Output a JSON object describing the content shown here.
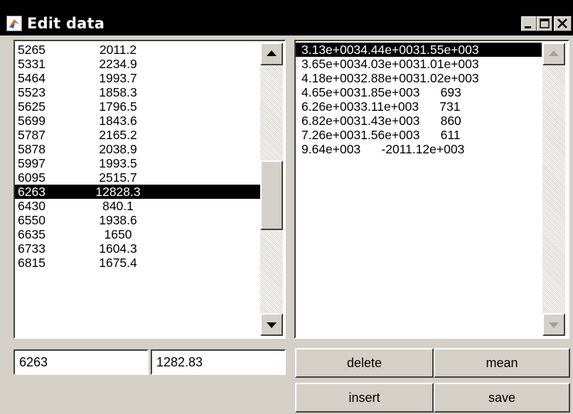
{
  "window": {
    "title": "Edit data"
  },
  "title_buttons": {
    "minimize": "minimize-icon",
    "maximize": "maximize-icon",
    "close": "close-icon"
  },
  "left_list": {
    "rows": [
      {
        "a": "5265",
        "b": "2011.2"
      },
      {
        "a": "5331",
        "b": "2234.9"
      },
      {
        "a": "5464",
        "b": "1993.7"
      },
      {
        "a": "5523",
        "b": "1858.3"
      },
      {
        "a": "5625",
        "b": "1796.5"
      },
      {
        "a": "5699",
        "b": "1843.6"
      },
      {
        "a": "5787",
        "b": "2165.2"
      },
      {
        "a": "5878",
        "b": "2038.9"
      },
      {
        "a": "5997",
        "b": "1993.5"
      },
      {
        "a": "6095",
        "b": "2515.7"
      },
      {
        "a": "6263",
        "b": "12828.3"
      },
      {
        "a": "6430",
        "b": "840.1"
      },
      {
        "a": "6550",
        "b": "1938.6"
      },
      {
        "a": "6635",
        "b": "1650"
      },
      {
        "a": "6733",
        "b": "1604.3"
      },
      {
        "a": "6815",
        "b": "1675.4"
      }
    ],
    "selected_index": 10
  },
  "right_list": {
    "rows": [
      "3.13e+0034.44e+0031.55e+003",
      "3.65e+0034.03e+0031.01e+003",
      "4.18e+0032.88e+0031.02e+003",
      "4.65e+0031.85e+003      693",
      "6.26e+0033.11e+003      731",
      "6.82e+0031.43e+003      860",
      "7.26e+0031.56e+003      611",
      "9.64e+003      -2011.12e+003"
    ],
    "selected_index": 0
  },
  "inputs": {
    "x_value": "6263",
    "y_value": "1282.83"
  },
  "buttons": {
    "delete": "delete",
    "mean": "mean",
    "insert": "insert",
    "save": "save"
  },
  "colors": {
    "face": "#d4d0c8",
    "selection": "#000000",
    "titlebar": "#000000"
  }
}
